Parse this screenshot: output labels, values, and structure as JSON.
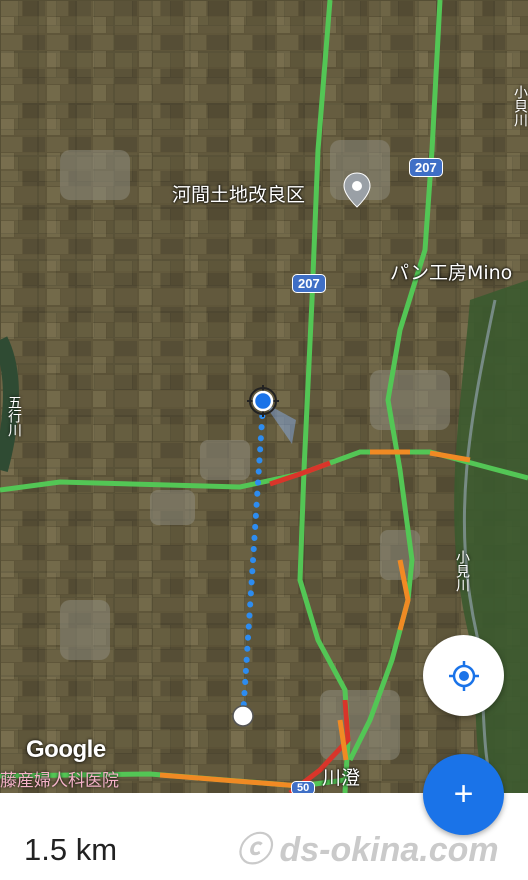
{
  "map": {
    "labels": {
      "place": "河間土地改良区",
      "bakery": "パン工房Mino",
      "town": "川澄",
      "clinic": "藤産婦人科医院",
      "river_right": "小見川",
      "river_left": "五行川",
      "river_top": "小貝川"
    },
    "route_shields": {
      "top": "207",
      "middle": "207",
      "bottom": "50"
    },
    "attribution": "Google",
    "colors": {
      "road": "#53c655",
      "traffic_red": "#d9352a",
      "traffic_orange": "#f08a24",
      "measure_line": "#2d8cf0",
      "pin": "#9aa0a6"
    }
  },
  "controls": {
    "locate_icon": "my-location-icon",
    "add_icon": "plus-icon",
    "add_label": "+"
  },
  "measurement": {
    "distance": "1.5 km"
  },
  "watermark": "ⓒ ds-okina.com"
}
